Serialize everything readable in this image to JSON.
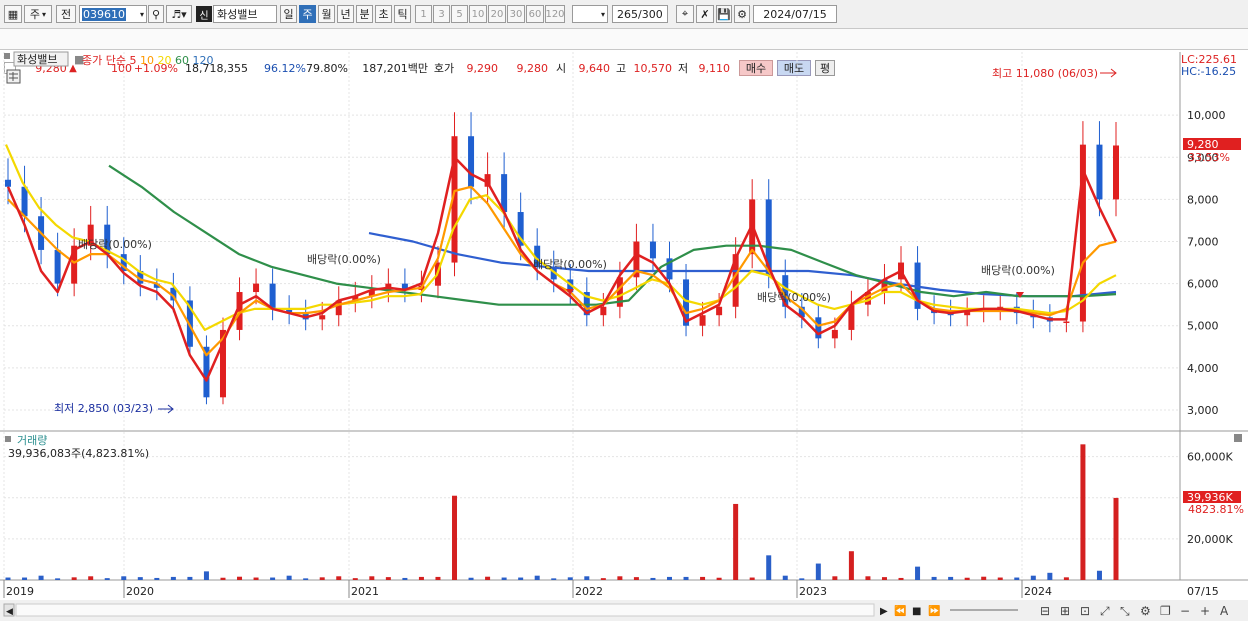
{
  "toolbar": {
    "period_type": "주",
    "prev_label": "전",
    "code": "039610",
    "name": "화성밸브",
    "sin_badge": "신",
    "periods": [
      "일",
      "주",
      "월",
      "년",
      "분",
      "초",
      "틱"
    ],
    "selected_period": "주",
    "intervals": [
      "1",
      "3",
      "5",
      "10",
      "20",
      "30",
      "60",
      "120"
    ],
    "count": "265",
    "max_count": "/300",
    "date": "2024/07/15"
  },
  "quote": {
    "price": "9,280",
    "arrow": "▲",
    "change": "100",
    "change_pct": "+1.09%",
    "volume": "18,718,355",
    "ratio1": "96.12%",
    "ratio2": "79.80%",
    "amount": "187,201백만",
    "hoga_label": "호가",
    "ask": "9,290",
    "bid": "9,280",
    "open_label": "시",
    "open": "9,640",
    "high_label": "고",
    "high": "10,570",
    "low_label": "저",
    "low": "9,110",
    "buy_label": "매수",
    "sell_label": "매도",
    "avg_label": "평"
  },
  "legend": {
    "name": "화성밸브",
    "ma_label": "종가 단순",
    "ma": [
      {
        "period": "5",
        "color": "#e0201f"
      },
      {
        "period": "10",
        "color": "#ff9900"
      },
      {
        "period": "20",
        "color": "#f4d800"
      },
      {
        "period": "60",
        "color": "#2f8f4a"
      },
      {
        "period": "120",
        "color": "#2f6fb8"
      }
    ]
  },
  "annotations": {
    "lc": "LC:225.61",
    "hc": "HC:-16.25",
    "high": "최고 11,080 (06/03)",
    "low": "최저 2,850 (03/23)",
    "dividends": [
      "배당락(0.00%)",
      "배당락(0.00%)",
      "배당락(0.00%)",
      "배당락(0.00%)",
      "배당락(0.00%)"
    ],
    "price_tag": "9,280",
    "price_pct": "33.53%",
    "vol_label": "거래량",
    "vol_value": "39,936,083주(4,823.81%)",
    "vol_tag": "39,936K",
    "vol_pct": "4823.81%"
  },
  "axes": {
    "price_ticks": [
      "10,000",
      "9,000",
      "8,000",
      "7,000",
      "6,000",
      "5,000",
      "4,000",
      "3,000"
    ],
    "price_tick_values": [
      10000,
      9000,
      8000,
      7000,
      6000,
      5000,
      4000,
      3000
    ],
    "vol_ticks": [
      "60,000K",
      "40,000K",
      "20,000K"
    ],
    "vol_tick_values": [
      60000,
      40000,
      20000
    ],
    "years": [
      "2019",
      "2020",
      "2021",
      "2022",
      "2023",
      "2024"
    ],
    "last_date": "07/15"
  },
  "chart_data": {
    "type": "candlestick",
    "x_range": [
      "2019-01",
      "2024-07-15"
    ],
    "y_range_price": [
      2500,
      11500
    ],
    "y_range_volume_k": [
      0,
      72000
    ],
    "closes": [
      8300,
      7600,
      6800,
      6000,
      6900,
      7400,
      6700,
      6300,
      6000,
      5900,
      5600,
      4500,
      3300,
      4900,
      5800,
      6000,
      5400,
      5300,
      5150,
      5250,
      5600,
      5700,
      5850,
      6000,
      5850,
      5950,
      6500,
      9500,
      8300,
      8600,
      7700,
      6900,
      6400,
      6100,
      5800,
      5250,
      5450,
      6150,
      7000,
      6600,
      6100,
      5000,
      5250,
      5450,
      6700,
      8000,
      6200,
      5450,
      5200,
      4700,
      4900,
      5500,
      5800,
      6100,
      6500,
      5400,
      5300,
      5250,
      5350,
      5400,
      5450,
      5300,
      5200,
      5100,
      5100,
      9300,
      8000,
      9280
    ],
    "ma5": [
      8300,
      7400,
      6300,
      5800,
      6800,
      7000,
      6700,
      6250,
      5950,
      5800,
      5400,
      4300,
      3700,
      4600,
      5500,
      5700,
      5400,
      5300,
      5200,
      5300,
      5600,
      5700,
      5850,
      5900,
      5850,
      6000,
      7200,
      9000,
      8600,
      8400,
      7700,
      6800,
      6300,
      6000,
      5700,
      5300,
      5500,
      6200,
      6700,
      6500,
      6000,
      5100,
      5300,
      5500,
      6600,
      7400,
      6400,
      5500,
      5200,
      4800,
      5000,
      5500,
      5800,
      6100,
      6300,
      5600,
      5350,
      5300,
      5350,
      5400,
      5400,
      5350,
      5250,
      5150,
      5150,
      8700,
      7800,
      7000
    ],
    "ma10": [
      8000,
      7600,
      7200,
      6800,
      6500,
      6700,
      6700,
      6400,
      6100,
      6000,
      5700,
      5000,
      4300,
      4700,
      5300,
      5600,
      5400,
      5300,
      5300,
      5350,
      5500,
      5600,
      5700,
      5800,
      5850,
      5900,
      6600,
      8200,
      8300,
      7900,
      7300,
      6700,
      6300,
      6000,
      5800,
      5400,
      5500,
      5900,
      6300,
      6200,
      5900,
      5300,
      5400,
      5600,
      6200,
      6800,
      6300,
      5700,
      5400,
      5000,
      5100,
      5500,
      5700,
      5900,
      6000,
      5600,
      5400,
      5350,
      5350,
      5350,
      5350,
      5350,
      5300,
      5250,
      5400,
      6500,
      6900,
      7000
    ],
    "ma20": [
      9300,
      8400,
      7800,
      7400,
      7100,
      7000,
      6800,
      6600,
      6300,
      6100,
      6000,
      5500,
      4900,
      5100,
      5300,
      5400,
      5400,
      5400,
      5400,
      5500,
      5500,
      5550,
      5600,
      5700,
      5700,
      5750,
      6200,
      7300,
      8000,
      8100,
      7700,
      7100,
      6600,
      6300,
      6000,
      5700,
      5600,
      5700,
      5900,
      6100,
      6000,
      5600,
      5500,
      5600,
      5900,
      6300,
      6200,
      5900,
      5700,
      5500,
      5400,
      5500,
      5600,
      5800,
      5800,
      5600,
      5500,
      5450,
      5400,
      5400,
      5400,
      5400,
      5350,
      5300,
      5350,
      5600,
      6000,
      6200
    ],
    "ma60": [
      8800,
      8300,
      7700,
      7200,
      6700,
      6400,
      6200,
      6000,
      5900,
      5800,
      5700,
      5600,
      5500,
      5500,
      5500,
      5500,
      5600,
      6400,
      6800,
      6900,
      6900,
      6800,
      6500,
      6200,
      6000,
      5800,
      5700,
      5800,
      5700,
      5700,
      5700,
      5750
    ],
    "ma120": [
      7200,
      7000,
      6700,
      6500,
      6400,
      6300,
      6300,
      6300,
      6300,
      6300,
      6300,
      6200,
      6000,
      5850,
      5750,
      5700,
      5700,
      5800
    ]
  }
}
